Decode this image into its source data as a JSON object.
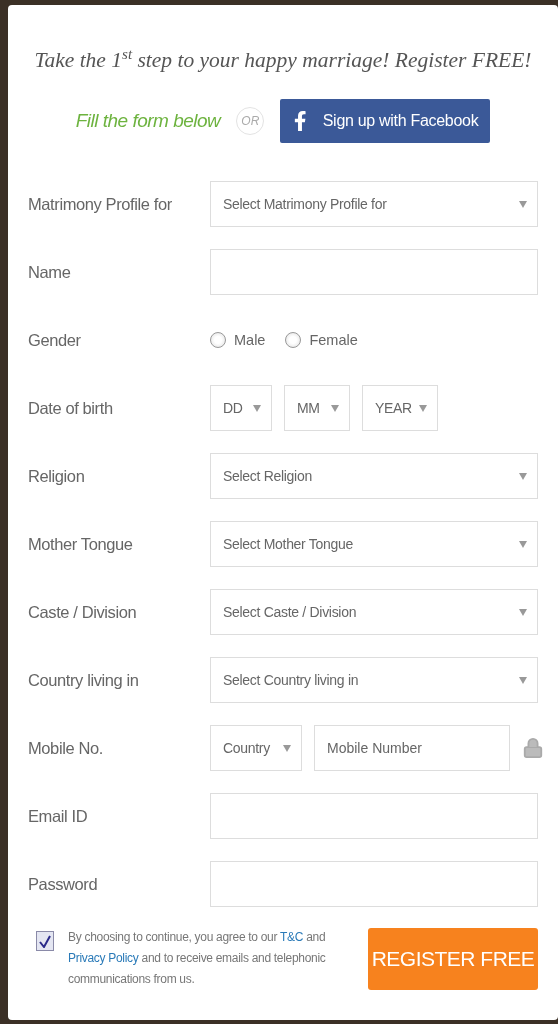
{
  "heading": "Take the 1$^{st}$ step to your happy marriage! Register FREE!",
  "intro": {
    "fill_label": "Fill the form below",
    "or_label": "OR",
    "facebook_button": "Sign up with Facebook"
  },
  "fields": [
    {
      "kind": "select",
      "label": "Matrimony Profile for",
      "value": "Select Matrimony Profile for"
    },
    {
      "kind": "text",
      "label": "Name"
    },
    {
      "kind": "radio",
      "label": "Gender",
      "options": [
        {
          "label": "Male",
          "selected": false
        },
        {
          "label": "Female",
          "selected": false
        }
      ]
    },
    {
      "kind": "date",
      "label": "Date of birth",
      "parts": [
        "DD",
        "MM",
        "YEAR"
      ]
    },
    {
      "kind": "select",
      "label": "Religion",
      "value": "Select Religion"
    },
    {
      "kind": "select",
      "label": "Mother Tongue",
      "value": "Select Mother Tongue"
    },
    {
      "kind": "select",
      "label": "Caste / Division",
      "value": "Select Caste / Division"
    },
    {
      "kind": "select",
      "label": "Country living in",
      "value": "Select Country living in"
    },
    {
      "kind": "mobile",
      "label": "Mobile No.",
      "country": "Country",
      "placeholder": "Mobile Number"
    },
    {
      "kind": "text",
      "label": "Email ID"
    },
    {
      "kind": "password",
      "label": "Password"
    }
  ],
  "agreement": {
    "checked": true,
    "parts": [
      {
        "text": "By choosing to continue, you agree to our ",
        "link": false
      },
      {
        "text": "T&C",
        "link": true
      },
      {
        "text": " and ",
        "link": false
      },
      {
        "text": "Privacy Policy",
        "link": true
      },
      {
        "text": " and to receive emails and telephonic communications from us.",
        "link": false
      }
    ]
  },
  "register_button": "REGISTER FREE"
}
